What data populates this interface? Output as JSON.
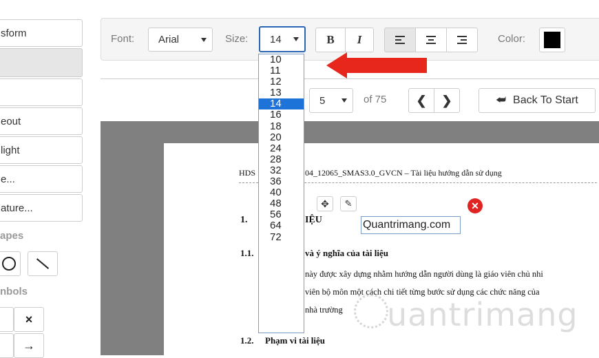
{
  "sidebar": {
    "transform_label": "sform",
    "items": [
      "eout",
      "light",
      "e...",
      "ature..."
    ],
    "shapes_heading": "apes",
    "symbols_heading": "nbols",
    "symbol_x": "×",
    "symbol_arrow": "→"
  },
  "toolbar": {
    "font_label": "Font:",
    "font_value": "Arial",
    "size_label": "Size:",
    "size_value": "14",
    "bold_label": "B",
    "italic_label": "I",
    "color_label": "Color:",
    "color_value": "#000000"
  },
  "size_dropdown": {
    "options": [
      "10",
      "11",
      "12",
      "13",
      "14",
      "16",
      "18",
      "20",
      "24",
      "28",
      "32",
      "36",
      "40",
      "48",
      "56",
      "64",
      "72"
    ],
    "selected": "14"
  },
  "navigation": {
    "page_value": "5",
    "page_total": "of 75",
    "back_label": "Back To Start"
  },
  "document": {
    "header_left": "HDS",
    "header_right": "04_12065_SMAS3.0_GVCN – Tài liệu hướng dẫn sử dụng",
    "section1_num": "1.",
    "section1_title": "IỆU",
    "textbox": "Quantrimang.com",
    "section11_num": "1.1.",
    "section11_title": "và ý nghĩa của tài liệu",
    "para_line1": "này được xây dựng nhằm hướng dẫn người dùng là giáo viên chủ nhi",
    "para_line2": "viên bộ môn một cách chi tiết từng bước sử dụng các chức năng của",
    "para_line3": "nhà trường",
    "section12_num": "1.2.",
    "section12_title": "Phạm vi tài liệu"
  },
  "watermark": "uantrimang",
  "colors": {
    "arrow": "#e8271c",
    "selected_option": "#1e73d8",
    "delete_icon": "#e02424"
  }
}
